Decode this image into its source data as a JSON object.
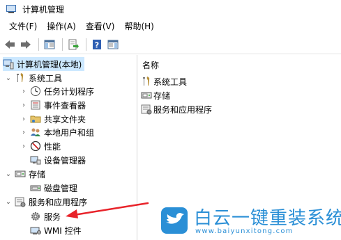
{
  "window": {
    "title": "计算机管理"
  },
  "menu": {
    "items": [
      {
        "label": "文件(F)"
      },
      {
        "label": "操作(A)"
      },
      {
        "label": "查看(V)"
      },
      {
        "label": "帮助(H)"
      }
    ]
  },
  "toolbar": {
    "buttons": [
      "back-icon",
      "forward-icon",
      "show-hide-tree-icon",
      "export-list-icon",
      "help-icon",
      "show-hide-action-pane-icon"
    ]
  },
  "tree": {
    "root": "计算机管理(本地)",
    "system_tools": "系统工具",
    "task_scheduler": "任务计划程序",
    "event_viewer": "事件查看器",
    "shared_folders": "共享文件夹",
    "local_users": "本地用户和组",
    "performance": "性能",
    "device_manager": "设备管理器",
    "storage": "存储",
    "disk_management": "磁盘管理",
    "services_apps": "服务和应用程序",
    "services": "服务",
    "wmi_control": "WMI 控件"
  },
  "list": {
    "column_name": "名称",
    "items": [
      {
        "label": "系统工具",
        "icon": "tools-icon"
      },
      {
        "label": "存储",
        "icon": "storage-icon"
      },
      {
        "label": "服务和应用程序",
        "icon": "services-apps-icon"
      }
    ]
  },
  "watermark": {
    "title": "白云一键重装系统",
    "url": "www.baiyunxitong.com"
  },
  "colors": {
    "selection": "#cce8ff",
    "annotation_arrow": "#e8232a",
    "watermark_blue": "#2a8fd6"
  }
}
